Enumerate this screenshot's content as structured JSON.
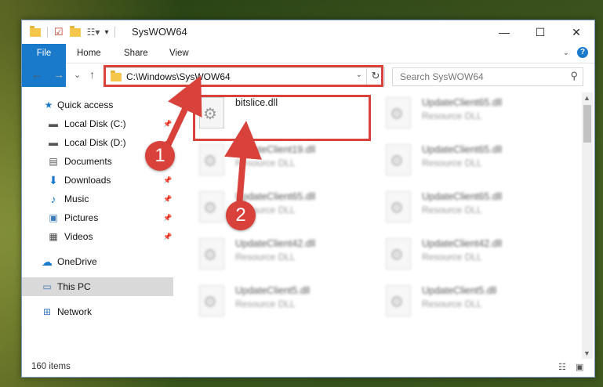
{
  "window": {
    "title": "SysWOW64",
    "controls": {
      "minimize": "—",
      "maximize": "☐",
      "close": "✕"
    }
  },
  "ribbon": {
    "tabs": [
      "File",
      "Home",
      "Share",
      "View"
    ]
  },
  "nav": {
    "back": "←",
    "forward": "→",
    "recent": "⌄",
    "up": "↑",
    "address": "C:\\Windows\\SysWOW64",
    "refresh": "↻",
    "search_placeholder": "Search SysWOW64"
  },
  "sidebar": {
    "items": [
      {
        "label": "Quick access",
        "icon": "star-icon",
        "pinned": false
      },
      {
        "label": "Local Disk (C:)",
        "icon": "drive-icon",
        "pinned": true
      },
      {
        "label": "Local Disk (D:)",
        "icon": "drive-icon",
        "pinned": true
      },
      {
        "label": "Documents",
        "icon": "documents-icon",
        "pinned": true
      },
      {
        "label": "Downloads",
        "icon": "download-icon",
        "pinned": true
      },
      {
        "label": "Music",
        "icon": "music-icon",
        "pinned": true
      },
      {
        "label": "Pictures",
        "icon": "pictures-icon",
        "pinned": true
      },
      {
        "label": "Videos",
        "icon": "videos-icon",
        "pinned": true
      },
      {
        "label": "OneDrive",
        "icon": "cloud-icon",
        "pinned": false
      },
      {
        "label": "This PC",
        "icon": "computer-icon",
        "pinned": false,
        "selected": true
      },
      {
        "label": "Network",
        "icon": "network-icon",
        "pinned": false
      }
    ]
  },
  "files": [
    {
      "name": "bitslice.dll",
      "type": ""
    },
    {
      "name": "UpdateClient65.dll",
      "type": "Resource DLL"
    },
    {
      "name": "UpdateClient19.dll",
      "type": "Resource DLL"
    },
    {
      "name": "UpdateClient65.dll",
      "type": "Resource DLL"
    },
    {
      "name": "UpdateClient65.dll",
      "type": "Resource DLL"
    },
    {
      "name": "UpdateClient65.dll",
      "type": "Resource DLL"
    },
    {
      "name": "UpdateClient42.dll",
      "type": "Resource DLL"
    },
    {
      "name": "UpdateClient42.dll",
      "type": "Resource DLL"
    },
    {
      "name": "UpdateClient5.dll",
      "type": "Resource DLL"
    },
    {
      "name": "UpdateClient5.dll",
      "type": "Resource DLL"
    }
  ],
  "status": {
    "count": "160 items"
  },
  "annotations": {
    "step1": "1",
    "step2": "2",
    "color": "#d9413b"
  }
}
